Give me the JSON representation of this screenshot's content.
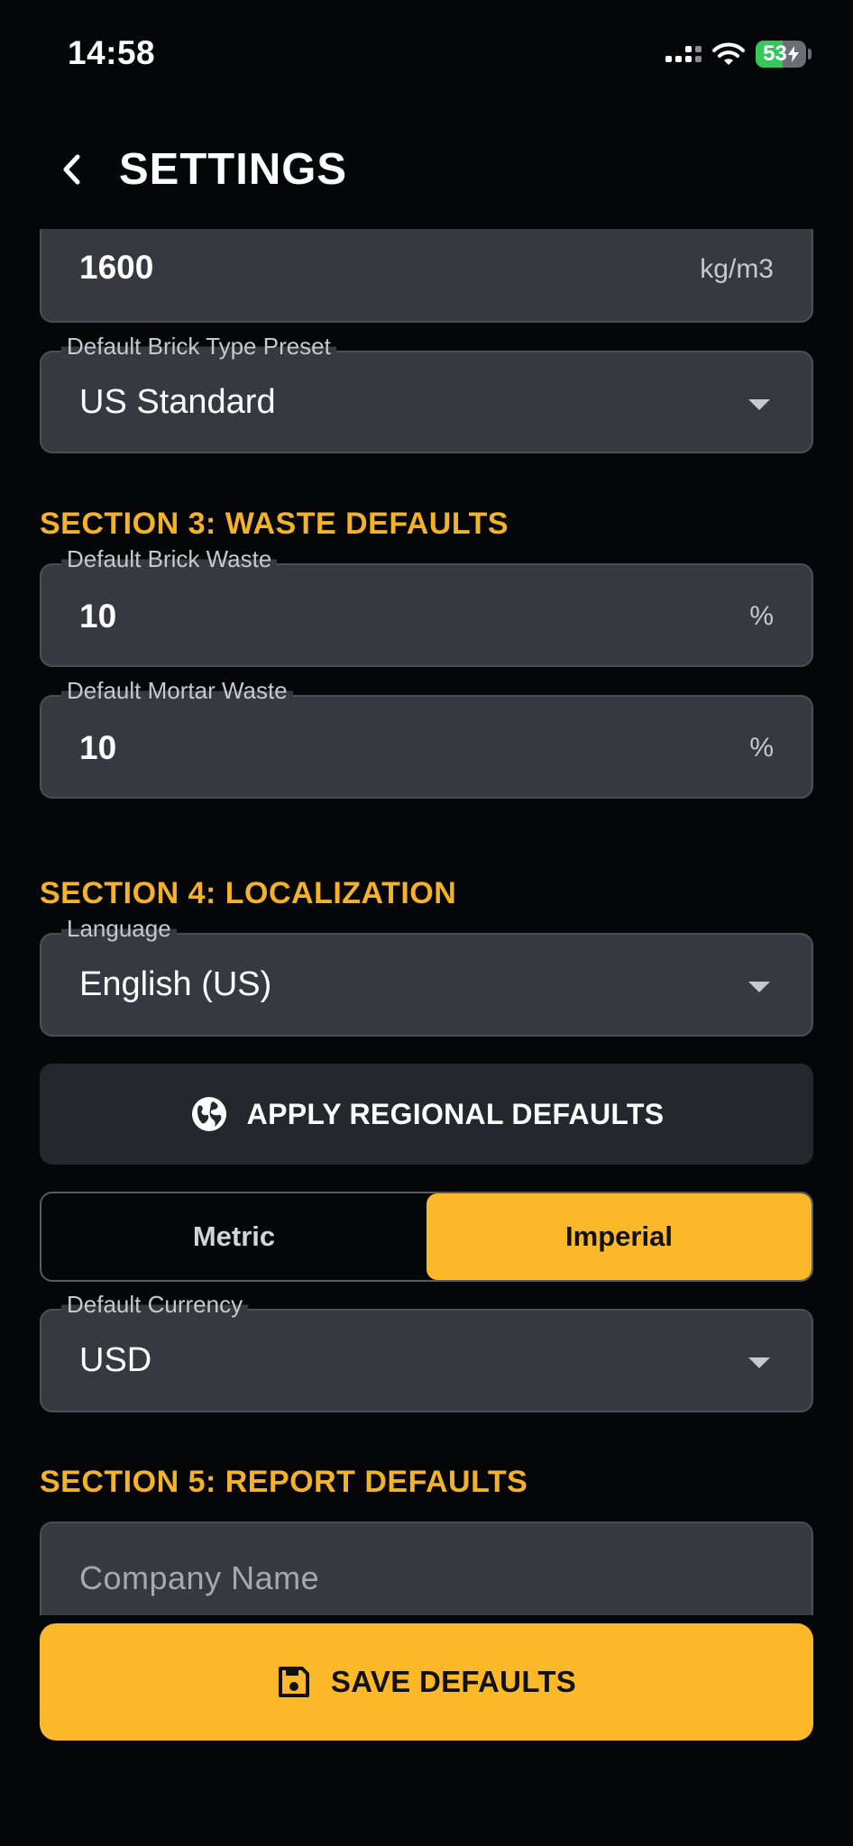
{
  "status_bar": {
    "time": "14:58",
    "battery_level": "53",
    "battery_fraction": 0.53
  },
  "header": {
    "title": "SETTINGS",
    "back_icon": "chevron-left-icon"
  },
  "fields": {
    "sand_density": {
      "value": "1600",
      "unit": "kg/m3"
    },
    "brick_type_preset": {
      "label": "Default Brick Type Preset",
      "value": "US Standard"
    },
    "brick_waste": {
      "label": "Default Brick Waste",
      "value": "10",
      "unit": "%"
    },
    "mortar_waste": {
      "label": "Default Mortar Waste",
      "value": "10",
      "unit": "%"
    },
    "language": {
      "label": "Language",
      "value": "English (US)"
    },
    "currency": {
      "label": "Default Currency",
      "value": "USD"
    },
    "company_name": {
      "placeholder": "Company Name"
    }
  },
  "sections": {
    "waste": "SECTION 3: WASTE DEFAULTS",
    "localization": "SECTION 4: LOCALIZATION",
    "report": "SECTION 5: REPORT DEFAULTS"
  },
  "regional_button": {
    "label": "APPLY REGIONAL DEFAULTS",
    "icon": "globe-icon"
  },
  "unit_system": {
    "options": [
      "Metric",
      "Imperial"
    ],
    "selected": "Imperial"
  },
  "save_button": {
    "label": "SAVE DEFAULTS",
    "icon": "floppy-disk-icon"
  },
  "colors": {
    "accent": "#fbb829",
    "background": "#050608",
    "field": "#363940",
    "section_heading": "#f4b228"
  }
}
